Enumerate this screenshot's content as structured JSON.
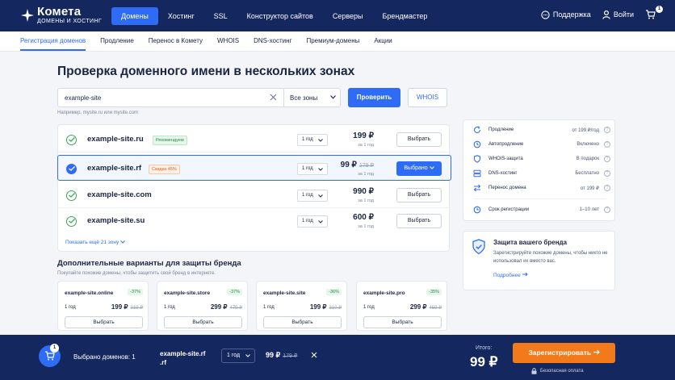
{
  "header": {
    "brand_name": "Комета",
    "brand_sub": "ДОМЕНЫ И ХОСТИНГ",
    "nav": [
      "Домены",
      "Хостинг",
      "SSL",
      "Конструктор сайтов",
      "Серверы",
      "Брендмастер"
    ],
    "support": "Поддержка",
    "login": "Войти",
    "cart_count": "1"
  },
  "subnav": [
    "Регистрация доменов",
    "Продление",
    "Перенос в Комету",
    "WHOIS",
    "DNS-хостинг",
    "Премиум-домены",
    "Акции"
  ],
  "title": "Проверка доменного имени в нескольких зонах",
  "search": {
    "value": "example-site",
    "zone": "Все зоны",
    "check": "Проверить",
    "whois": "WHOIS",
    "hint": "Например, mysite.ru или mysite.com"
  },
  "results": [
    {
      "name": "example-site.ru",
      "badge": "Рекомендуем",
      "years": "1 год",
      "price": "199 ₽",
      "old": "",
      "per": "за 1 год",
      "btn": "Выбрать"
    },
    {
      "name": "example-site.rf",
      "badge": "Скидка 45%",
      "years": "1 год",
      "price": "99 ₽",
      "old": "179 ₽",
      "per": "за 1 год",
      "btn": "Выбрано"
    },
    {
      "name": "example-site.com",
      "badge": "",
      "years": "1 год",
      "price": "990 ₽",
      "old": "",
      "per": "за 1 год",
      "btn": "Выбрать"
    },
    {
      "name": "example-site.su",
      "badge": "",
      "years": "1 год",
      "price": "600 ₽",
      "old": "",
      "per": "за 1 год",
      "btn": "Выбрать"
    }
  ],
  "show_more": "Показать ещё 21 зону",
  "alt": {
    "title": "Дополнительные варианты для защиты бренда",
    "subtitle": "Покупайте похожие домены, чтобы защитить свой бренд в интернете.",
    "cards": [
      {
        "name": "example-site.online",
        "disc": "-37%",
        "years": "1 год",
        "price": "199 ₽",
        "old": "319 ₽",
        "btn": "Выбрать"
      },
      {
        "name": "example-site.store",
        "disc": "-37%",
        "years": "1 год",
        "price": "299 ₽",
        "old": "479 ₽",
        "btn": "Выбрать"
      },
      {
        "name": "example-site.site",
        "disc": "-36%",
        "years": "1 год",
        "price": "199 ₽",
        "old": "310 ₽",
        "btn": "Выбрать"
      },
      {
        "name": "example-site.pro",
        "disc": "-35%",
        "years": "1 год",
        "price": "299 ₽",
        "old": "459 ₽",
        "btn": "Выбрать"
      }
    ]
  },
  "info": [
    {
      "label": "Продление",
      "value": "от 199 ₽/год"
    },
    {
      "label": "Автопродление",
      "value": "Включено"
    },
    {
      "label": "WHOIS-защита",
      "value": "В подарок"
    },
    {
      "label": "DNS-хостинг",
      "value": "Бесплатно"
    },
    {
      "label": "Перенос домена",
      "value": "от 199 ₽"
    },
    {
      "label": "Срок регистрации",
      "value": "1–10 лет"
    }
  ],
  "protect": {
    "title": "Защита вашего бренда",
    "text": "Зарегистрируйте похожие домены, чтобы никто не использовал их вместо вас.",
    "more": "Подробнее"
  },
  "footer": {
    "cart_count": "1",
    "selected": "Выбрано доменов: 1",
    "domain_line1": "example-site.rf",
    "domain_line2": ".rf",
    "years": "1 год",
    "price": "99 ₽",
    "old": "179 ₽",
    "total_label": "Итого:",
    "total": "99 ₽",
    "register": "Зарегистрировать",
    "safe": "Безопасная оплата"
  },
  "colors": {
    "brand": "#14275e",
    "accent": "#2f6cf6",
    "cta": "#f27a1a",
    "success": "#3aaa5c"
  }
}
